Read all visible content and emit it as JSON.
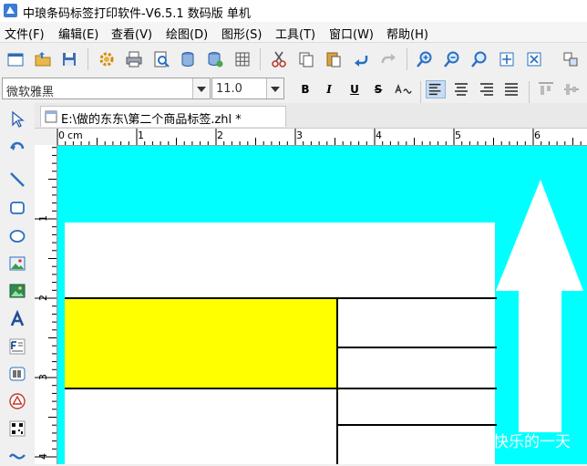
{
  "window": {
    "title": "中琅条码标签打印软件-V6.5.1 数码版 单机"
  },
  "menu": {
    "items": [
      {
        "label": "文件(F)"
      },
      {
        "label": "编辑(E)"
      },
      {
        "label": "查看(V)"
      },
      {
        "label": "绘图(D)"
      },
      {
        "label": "图形(S)"
      },
      {
        "label": "工具(T)"
      },
      {
        "label": "窗口(W)"
      },
      {
        "label": "帮助(H)"
      }
    ]
  },
  "format_toolbar": {
    "font_name": "微软雅黑",
    "font_size": "11.0",
    "bold_label": "B",
    "italic_label": "I",
    "underline_label": "U",
    "strikethrough_label": "S"
  },
  "document": {
    "tab_name": "E:\\做的东东\\第二个商品标签.zhl *"
  },
  "ruler": {
    "unit": "cm",
    "h_labels": [
      "0",
      "1",
      "2",
      "3",
      "4",
      "5",
      "6"
    ],
    "v_labels": [
      "1",
      "2",
      "3",
      "4"
    ]
  },
  "canvas": {
    "background_color": "#00ffff",
    "label_fill_color": "#ffffff",
    "highlight_color": "#ffff00"
  },
  "watermark": {
    "text": "知乎 @小C快乐的一天"
  }
}
